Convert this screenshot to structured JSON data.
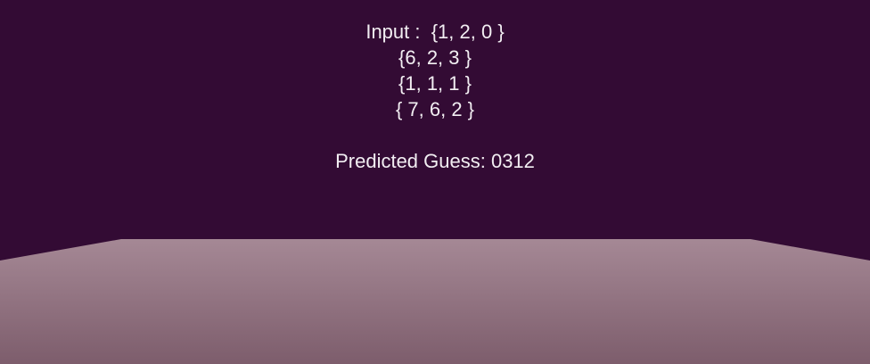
{
  "colors": {
    "sky": "#330b34",
    "floor_far": "#a58895",
    "floor_near": "#7d5d6c",
    "text": "#f2eef2"
  },
  "input": {
    "lines": [
      "Input :  {1, 2, 0 }",
      "{6, 2, 3 }",
      "{1, 1, 1 }",
      "{ 7, 6, 2 }"
    ]
  },
  "prediction": {
    "text": "Predicted Guess: 0312"
  }
}
